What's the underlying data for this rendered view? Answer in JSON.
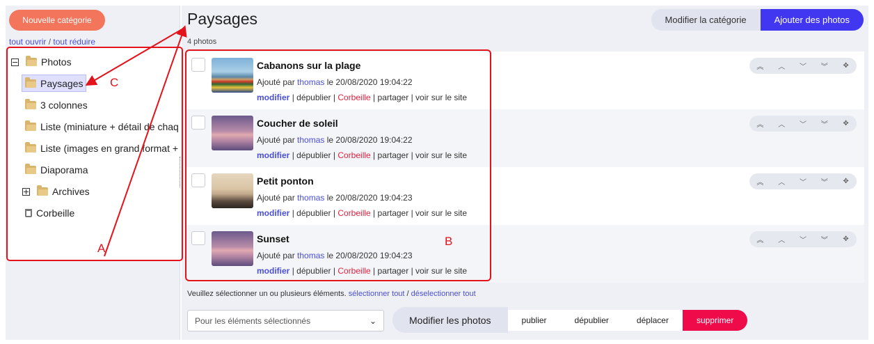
{
  "sidebar": {
    "new_category_label": "Nouvelle catégorie",
    "open_all": "tout ouvrir",
    "separator": "/",
    "collapse_all": "tout réduire",
    "tree": {
      "root": "Photos",
      "items": [
        "Paysages",
        "3 colonnes",
        "Liste (miniature + détail de chaq",
        "Liste (images en grand format +",
        "Diaporama",
        "Archives"
      ],
      "trash": "Corbeille"
    }
  },
  "main": {
    "title": "Paysages",
    "count": "4 photos",
    "edit_category_label": "Modifier la catégorie",
    "add_photos_label": "Ajouter des photos"
  },
  "photos": [
    {
      "title": "Cabanons sur la plage",
      "added_by": "Ajouté par",
      "author": "thomas",
      "date": "le 20/08/2020 19:04:22"
    },
    {
      "title": "Coucher de soleil",
      "added_by": "Ajouté par",
      "author": "thomas",
      "date": "le 20/08/2020 19:04:22"
    },
    {
      "title": "Petit ponton",
      "added_by": "Ajouté par",
      "author": "thomas",
      "date": "le 20/08/2020 19:04:23"
    },
    {
      "title": "Sunset",
      "added_by": "Ajouté par",
      "author": "thomas",
      "date": "le 20/08/2020 19:04:23"
    }
  ],
  "row_actions": {
    "edit": "modifier",
    "unpublish": "dépublier",
    "trash": "Corbeille",
    "share": "partager",
    "view": "voir sur le site",
    "sep": "|"
  },
  "order_icons": [
    "move-top-icon",
    "move-up-icon",
    "move-down-icon",
    "move-bottom-icon",
    "drag-handle-icon"
  ],
  "order_glyphs": [
    "︽",
    "︿",
    "﹀",
    "︾",
    "✥"
  ],
  "footer": {
    "hint": "Veuillez sélectionner un ou plusieurs éléments.",
    "select_all": "sélectionner tout",
    "sep": "/",
    "deselect_all": "déselectionner tout",
    "bulk_placeholder": "Pour les éléments sélectionnés",
    "bulk_label": "Modifier les photos",
    "publish": "publier",
    "unpublish": "dépublier",
    "move": "déplacer",
    "delete": "supprimer"
  },
  "annotations": {
    "a": "A",
    "b": "B",
    "c": "C"
  },
  "colors": {
    "accent": "#4137f0",
    "new_button": "#f3765c",
    "danger": "#ef0a4a",
    "annotation": "#e3121b",
    "link": "#4a4fd6"
  }
}
